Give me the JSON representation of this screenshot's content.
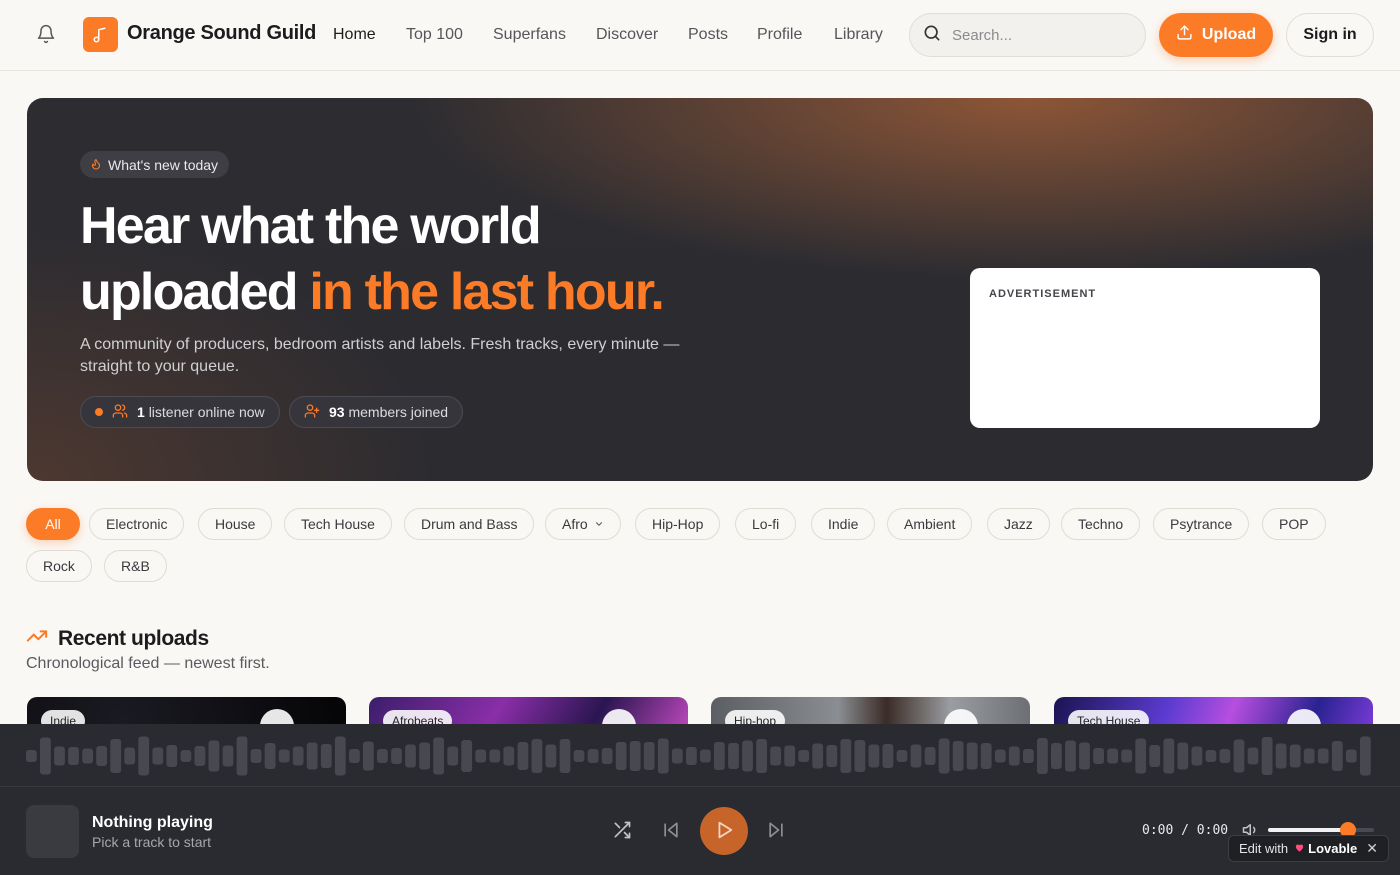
{
  "header": {
    "brand": "Orange Sound Guild",
    "nav": [
      "Home",
      "Top 100",
      "Superfans",
      "Discover",
      "Posts",
      "Profile",
      "Library"
    ],
    "active_nav": "Home",
    "search_placeholder": "Search...",
    "upload_label": "Upload",
    "signin_label": "Sign in"
  },
  "hero": {
    "badge": "What's new today",
    "title_line1": "Hear what the world",
    "title_line2_plain": "uploaded",
    "title_line2_accent": "in the last hour.",
    "subtitle": "A community of producers, bedroom artists and labels. Fresh tracks, every minute — straight to your queue.",
    "listeners_count": "1",
    "listeners_text": "listener online now",
    "members_count": "93",
    "members_text": "members joined",
    "ad_label": "ADVERTISEMENT"
  },
  "genres": {
    "items": [
      "All",
      "Electronic",
      "House",
      "Tech House",
      "Drum and Bass",
      "Afro",
      "Hip-Hop",
      "Lo-fi",
      "Indie",
      "Ambient",
      "Jazz",
      "Techno",
      "Psytrance",
      "POP",
      "Rock",
      "R&B"
    ],
    "active": "All",
    "dropdown": "Afro"
  },
  "recent": {
    "title": "Recent uploads",
    "subtitle": "Chronological feed — newest first.",
    "cards": [
      {
        "tag": "Indie"
      },
      {
        "tag": "Afrobeats"
      },
      {
        "tag": "Hip-hop"
      },
      {
        "tag": "Tech House"
      }
    ]
  },
  "player": {
    "title": "Nothing playing",
    "subtitle": "Pick a track to start",
    "time": "0:00 / 0:00",
    "volume": 0.75
  },
  "lovable": {
    "prefix": "Edit with",
    "brand": "Lovable",
    "close": "✕"
  },
  "colors": {
    "accent": "#fb7b27",
    "hero_bg": "#2b2b30",
    "player_bg": "#2a2b30",
    "page_bg": "#faf8f5"
  }
}
